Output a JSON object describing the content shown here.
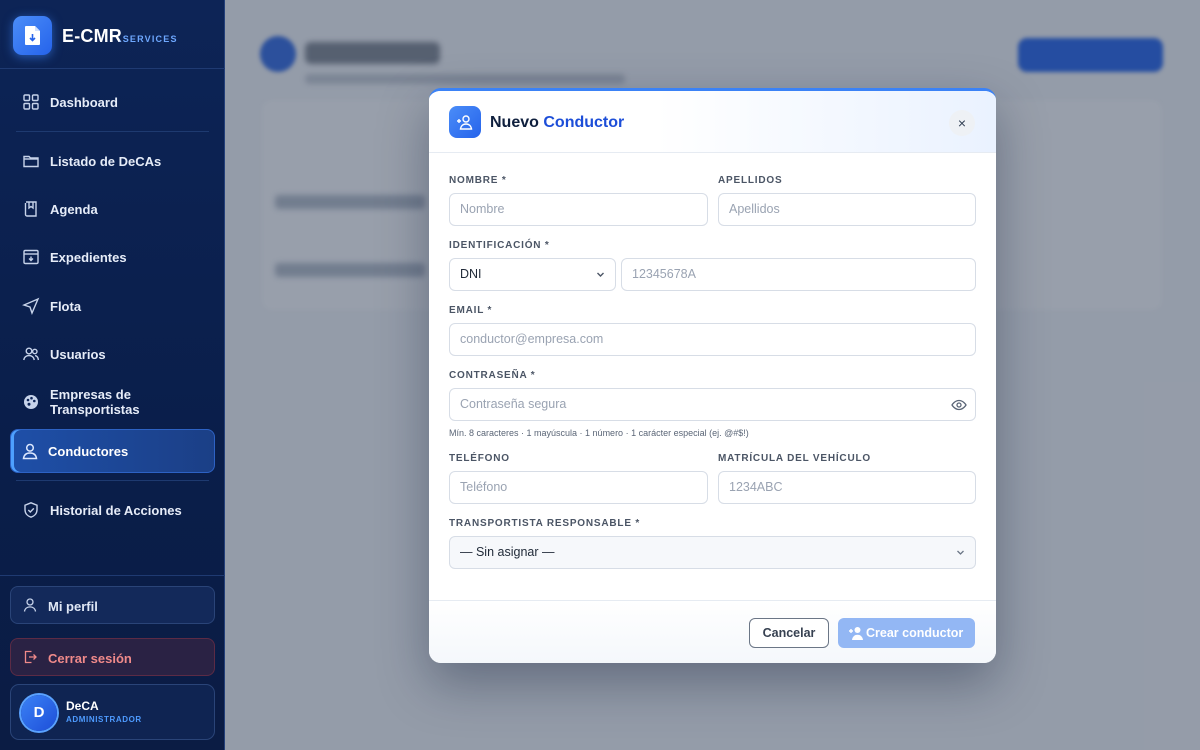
{
  "brand": {
    "name": "E-CMR",
    "suffix": ".SERVICES"
  },
  "sidebar": {
    "items": [
      {
        "label": "Dashboard",
        "icon": "dashboard-grid-icon"
      },
      {
        "label": "Listado de DeCAs",
        "icon": "folder-icon"
      },
      {
        "label": "Agenda",
        "icon": "book-icon"
      },
      {
        "label": "Expedientes",
        "icon": "archive-icon"
      },
      {
        "label": "Flota",
        "icon": "navigation-icon"
      },
      {
        "label": "Usuarios",
        "icon": "users-icon"
      },
      {
        "label": "Empresas de Transportistas",
        "icon": "palette-icon"
      },
      {
        "label": "Conductores",
        "icon": "user-icon",
        "active": true
      },
      {
        "label": "Historial de Acciones",
        "icon": "shield-icon"
      }
    ],
    "profile_label": "Mi perfil",
    "logout_label": "Cerrar sesión",
    "user": {
      "initial": "D",
      "name": "DeCA",
      "role": "ADMINISTRADOR"
    }
  },
  "modal": {
    "title_prefix": "Nuevo",
    "title_accent": "Conductor",
    "close_glyph": "×",
    "fields": {
      "nombre": {
        "label": "NOMBRE *",
        "placeholder": "Nombre"
      },
      "apellidos": {
        "label": "APELLIDOS",
        "placeholder": "Apellidos"
      },
      "identificacion": {
        "label": "IDENTIFICACIÓN *",
        "type_value": "DNI",
        "placeholder": "12345678A"
      },
      "email": {
        "label": "EMAIL *",
        "placeholder": "conductor@empresa.com"
      },
      "password": {
        "label": "CONTRASEÑA *",
        "placeholder": "Contraseña segura",
        "hint": "Mín. 8 caracteres · 1 mayúscula · 1 número · 1 carácter especial (ej. @#$!)"
      },
      "telefono": {
        "label": "TELÉFONO",
        "placeholder": "Teléfono"
      },
      "matricula": {
        "label": "MATRÍCULA DEL VEHÍCULO",
        "placeholder": "1234ABC"
      },
      "transportista": {
        "label": "TRANSPORTISTA RESPONSABLE *",
        "value": "— Sin asignar —"
      }
    },
    "cancel_label": "Cancelar",
    "create_label": "Crear conductor"
  },
  "colors": {
    "accent": "#2563eb",
    "sidebar_bg": "#0d2456",
    "logout_text": "#f08a8a",
    "create_disabled": "#93b7f4"
  }
}
